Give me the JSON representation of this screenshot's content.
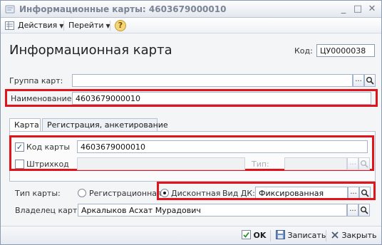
{
  "window": {
    "title": "Информационные карты: 4603679000010"
  },
  "toolbar": {
    "actions_label": "Действия",
    "goto_label": "Перейти",
    "help_label": "?"
  },
  "header": {
    "title": "Информационная карта",
    "code_label": "Код:",
    "code_value": "ЦУ0000038"
  },
  "group": {
    "label": "Группа карт:",
    "value": "",
    "dots": "...",
    "search_icon": "magnifier"
  },
  "name": {
    "label": "Наименование:",
    "value": "4603679000010"
  },
  "tabs": [
    {
      "label": "Карта"
    },
    {
      "label": "Регистрация, анкетирование"
    }
  ],
  "card_code": {
    "label": "Код карты",
    "value": "4603679000010",
    "checked": true,
    "check_glyph": "✓"
  },
  "barcode": {
    "label": "Штрихкод",
    "value": "",
    "checked": false,
    "type_label": "Тип:",
    "type_value": "",
    "dots": "..."
  },
  "card_type": {
    "label": "Тип карты:",
    "option_registration": "Регистрационная",
    "option_discount": "Дисконтная",
    "selected": "Дисконтная",
    "dk_label": "Вид ДК:",
    "dk_value": "Фиксированная",
    "dots": "..."
  },
  "owner": {
    "label": "Владелец карты:",
    "value": "Аркалыков Асхат Мурадович",
    "dots": "..."
  },
  "footer": {
    "ok_label": "OK",
    "save_label": "Записать",
    "close_label": "Закрыть"
  },
  "colors": {
    "highlight": "#e0141a",
    "ok_green": "#2f8f2f"
  }
}
